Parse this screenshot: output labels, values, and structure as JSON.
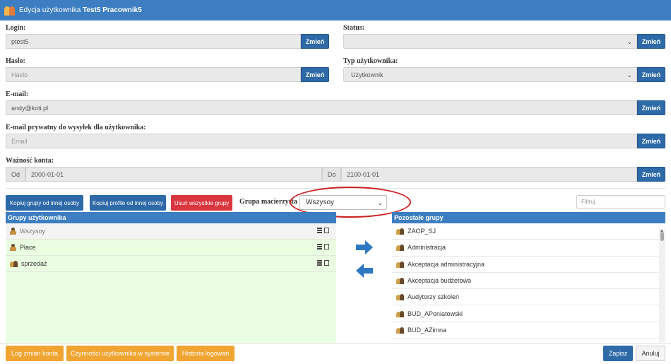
{
  "window": {
    "title_prefix": "Edycja użytkownika",
    "title_user": "Test5 Pracownik5"
  },
  "form": {
    "login": {
      "label": "Login:",
      "value": "ptest5",
      "button": "Zmień"
    },
    "status": {
      "label": "Status:",
      "value": "",
      "button": "Zmień"
    },
    "password": {
      "label": "Hasło:",
      "placeholder": "Hasło",
      "button": "Zmień"
    },
    "user_type": {
      "label": "Typ użytkownika:",
      "value": "Użytkownik",
      "button": "Zmień"
    },
    "email": {
      "label": "E-mail:",
      "value": "andy@koti.pl",
      "button": "Zmień"
    },
    "private_email": {
      "label": "E-mail prywatny do wysyłek dla użytkownika:",
      "placeholder": "Email",
      "button": "Zmień"
    },
    "validity": {
      "label": "Ważność konta:",
      "from_label": "Od",
      "from_value": "2000-01-01",
      "to_label": "Do",
      "to_value": "2100-01-01",
      "button": "Zmień"
    }
  },
  "actions": {
    "copy_groups": "Kopiuj grupy od innej osoby",
    "copy_profiles": "Kopiuj profile od innej osoby",
    "remove_groups": "Usuń wszystkie grupy",
    "parent_group_label": "Grupa macierzysta",
    "parent_group_value": "Wszysoy",
    "filter_placeholder": "Filtruj"
  },
  "user_groups": {
    "header": "Grupy użytkownika",
    "items": [
      {
        "label": "Wszysoy"
      },
      {
        "label": "Płace"
      },
      {
        "label": "sprzedaż"
      }
    ]
  },
  "other_groups": {
    "header": "Pozostałe grupy",
    "items": [
      {
        "label": "ZAOP_SJ"
      },
      {
        "label": "Administracja"
      },
      {
        "label": "Akceptacja administracyjna"
      },
      {
        "label": "Akceptacja budżetowa"
      },
      {
        "label": "Audytorzy szkoleń"
      },
      {
        "label": "BUD_APoniatowski"
      },
      {
        "label": "BUD_AZimna"
      }
    ]
  },
  "footer": {
    "account_log": "Log zmian konta",
    "user_activity": "Czynności użytkownika w systemie",
    "login_history": "Historia logowań",
    "save": "Zapisz",
    "cancel": "Anuluj"
  },
  "colors": {
    "header_blue": "#3c7ec1",
    "button_blue": "#2e6aa8",
    "danger_red": "#d9363e",
    "orange": "#f0a431",
    "assigned_bg": "#eaffe2",
    "highlight_ellipse": "#cc2020"
  }
}
